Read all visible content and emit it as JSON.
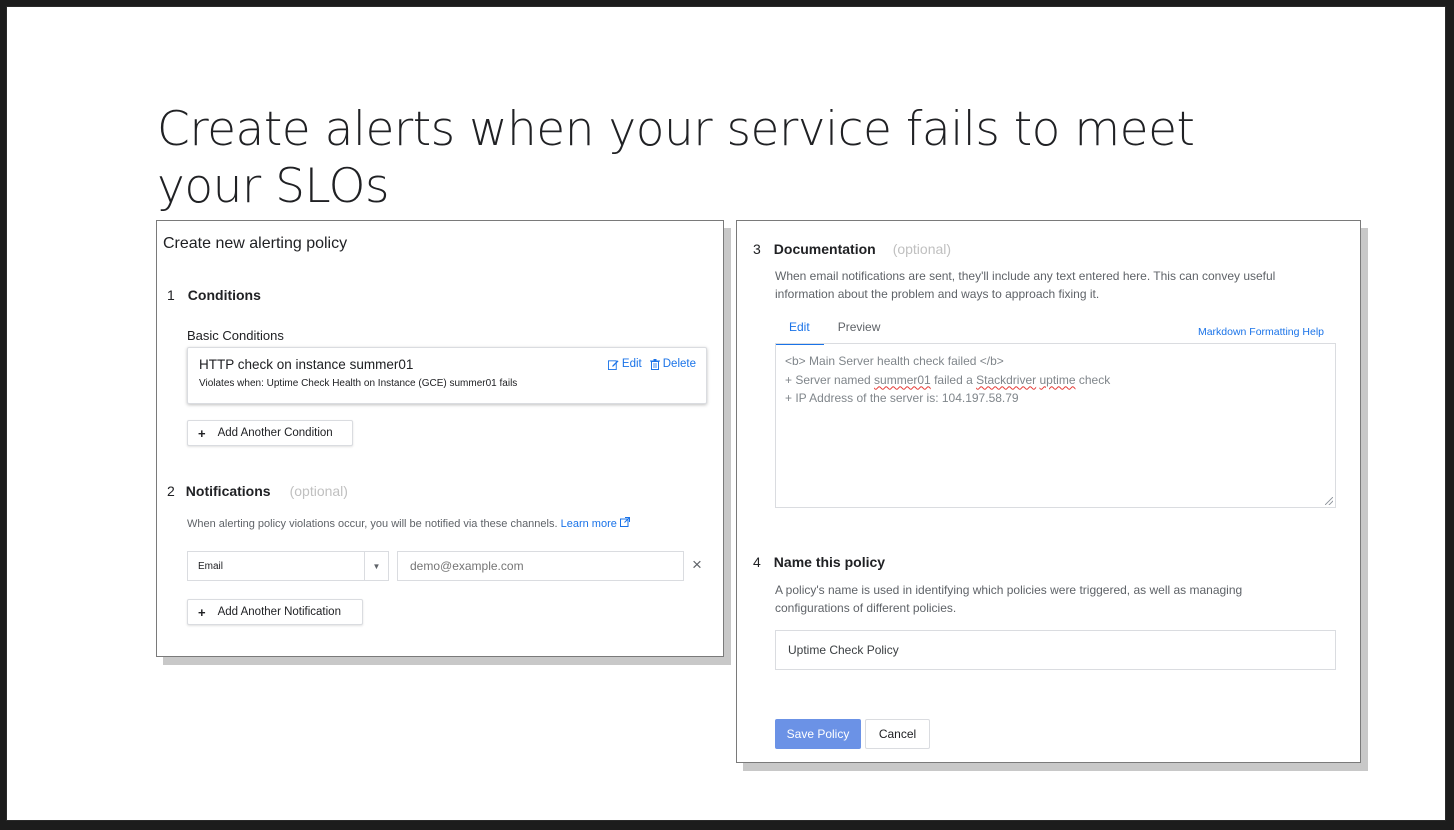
{
  "slide": {
    "title": "Create alerts when your service fails to meet your SLOs"
  },
  "left_panel": {
    "heading": "Create new alerting policy",
    "conditions": {
      "number": "1",
      "title": "Conditions",
      "subheading": "Basic Conditions",
      "card": {
        "title": "HTTP check on instance summer01",
        "subtitle": "Violates when: Uptime Check Health on Instance (GCE) summer01 fails",
        "edit_label": "Edit",
        "delete_label": "Delete"
      },
      "add_button": "Add Another Condition"
    },
    "notifications": {
      "number": "2",
      "title": "Notifications",
      "optional": "(optional)",
      "description": "When alerting policy violations occur, you will be notified via these channels.",
      "learn_more": "Learn more",
      "channel_type": "Email",
      "channel_placeholder": "demo@example.com",
      "add_button": "Add Another Notification"
    }
  },
  "right_panel": {
    "documentation": {
      "number": "3",
      "title": "Documentation",
      "optional": "(optional)",
      "description_line1": "When email notifications are sent, they'll include any text entered here. This can convey useful",
      "description_line2": "information about the problem and ways to approach fixing it.",
      "tab_edit": "Edit",
      "tab_preview": "Preview",
      "markdown_help": "Markdown Formatting Help",
      "content": {
        "line1": "<b> Main Server health check failed </b>",
        "line2_prefix": "+ Server named ",
        "line2_word1": "summer01",
        "line2_mid": " failed a ",
        "line2_word2": "Stackdriver",
        "line2_space": " ",
        "line2_word3": "uptime",
        "line2_suffix": " check",
        "line3": "+ IP Address of the server is: 104.197.58.79"
      }
    },
    "name_policy": {
      "number": "4",
      "title": "Name this policy",
      "description_line1": "A policy's name is used in identifying which policies were triggered, as well as managing",
      "description_line2": "configurations of different policies.",
      "value": "Uptime Check Policy"
    },
    "save_label": "Save Policy",
    "cancel_label": "Cancel"
  },
  "colors": {
    "accent": "#1a73e8",
    "primary_button": "#6b92e6",
    "optional_text": "#c0c0c0"
  }
}
